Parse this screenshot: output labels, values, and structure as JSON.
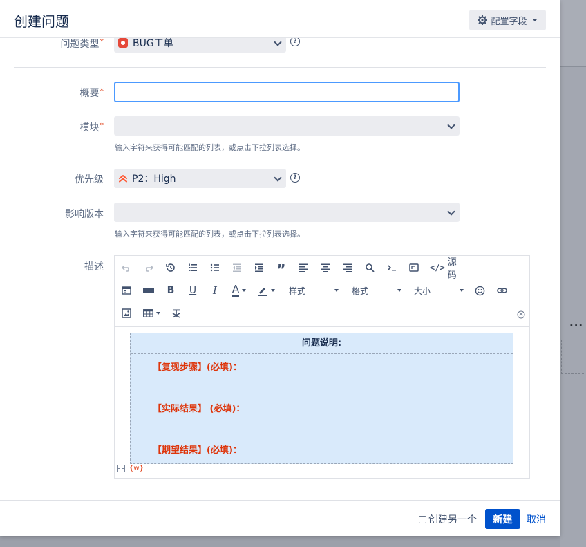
{
  "dialog": {
    "title": "创建问题",
    "config_button": "配置字段"
  },
  "fields": {
    "issue_type": {
      "label": "问题类型",
      "required": "*",
      "value": "BUG工单",
      "help": "?"
    },
    "summary": {
      "label": "概要",
      "required": "*",
      "value": ""
    },
    "module": {
      "label": "模块",
      "required": "*",
      "value": "",
      "hint": "输入字符来获得可能匹配的列表，或点击下拉列表选择。"
    },
    "priority": {
      "label": "优先级",
      "value": "P2：High",
      "help": "?"
    },
    "affects_version": {
      "label": "影响版本",
      "value": "",
      "hint": "输入字符来获得可能匹配的列表，或点击下拉列表选择。"
    },
    "description": {
      "label": "描述"
    }
  },
  "editor": {
    "toolbar": {
      "source_label": "源码",
      "style_label": "样式",
      "format_label": "格式",
      "size_label": "大小",
      "font_color_letter": "A"
    },
    "panel": {
      "heading": "问题说明:",
      "lines": [
        "【复现步骤】(必填)：",
        "【实际结果】 (必填)：",
        "【期望结果】(必填)："
      ]
    },
    "macro_label": "{w}"
  },
  "footer": {
    "create_another": "创建另一个",
    "create": "新建",
    "cancel": "取消"
  },
  "colors": {
    "primary": "#0052cc",
    "required": "#de350b",
    "focus_border": "#4c9aff",
    "panel_bg": "#d9eafb"
  }
}
